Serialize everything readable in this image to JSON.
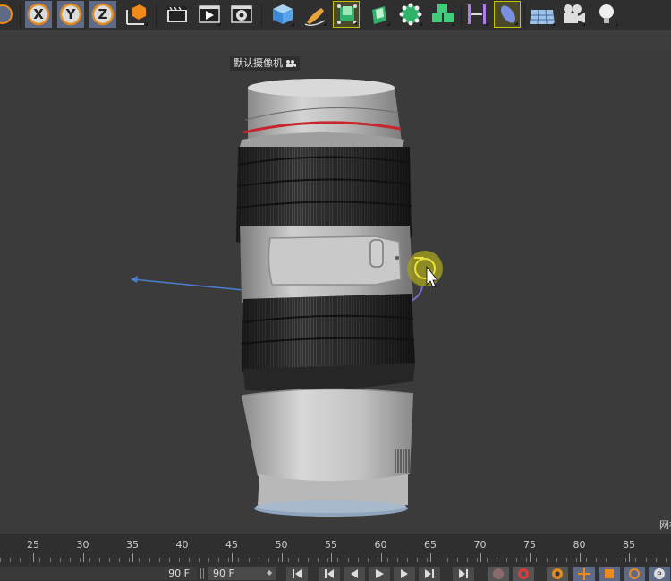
{
  "toolbar": {
    "buttons": [
      {
        "id": "axis-x",
        "label": "X"
      },
      {
        "id": "axis-y",
        "label": "Y"
      },
      {
        "id": "axis-z",
        "label": "Z"
      }
    ]
  },
  "viewport": {
    "camera_label": "默认摄像机",
    "grid_label": "网格"
  },
  "timeline": {
    "ruler_labels": [
      "25",
      "30",
      "35",
      "40",
      "45",
      "50",
      "55",
      "60",
      "65",
      "70",
      "75",
      "80",
      "85"
    ],
    "end_frame_left": "90 F",
    "end_frame_value": "90 F"
  },
  "colors": {
    "accent_yellow": "#c8c200",
    "axis_blue": "#4a7fcf",
    "lens_red": "#c8262c"
  },
  "icons": [
    "coordinate-system-icon",
    "axis-x-icon",
    "axis-y-icon",
    "axis-z-icon",
    "world-coordinates-icon",
    "render-view-icon",
    "render-picture-viewer-icon",
    "render-settings-icon",
    "cube-icon",
    "pen-icon",
    "subdivision-icon",
    "extrude-icon",
    "polygon-mesh-icon",
    "cloner-icon",
    "deformer-icon",
    "bend-icon",
    "floor-icon",
    "camera-icon",
    "light-icon"
  ]
}
